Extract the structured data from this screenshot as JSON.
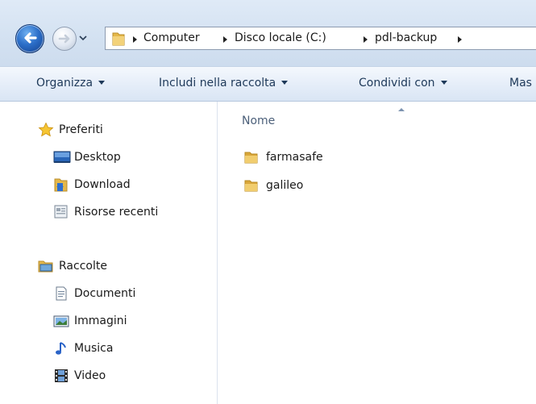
{
  "address_bar": {
    "breadcrumbs": [
      "Computer",
      "Disco locale (C:)",
      "pdl-backup"
    ]
  },
  "toolbar": {
    "organize_label": "Organizza",
    "include_label": "Includi nella raccolta",
    "share_label": "Condividi con",
    "more_label": "Mas"
  },
  "nav": {
    "favorites": {
      "label": "Preferiti",
      "items": [
        {
          "label": "Desktop",
          "icon": "desktop-icon"
        },
        {
          "label": "Download",
          "icon": "downloads-folder-icon"
        },
        {
          "label": "Risorse recenti",
          "icon": "recent-places-icon"
        }
      ]
    },
    "libraries": {
      "label": "Raccolte",
      "items": [
        {
          "label": "Documenti",
          "icon": "documents-icon"
        },
        {
          "label": "Immagini",
          "icon": "pictures-icon"
        },
        {
          "label": "Musica",
          "icon": "music-icon"
        },
        {
          "label": "Video",
          "icon": "video-icon"
        }
      ]
    }
  },
  "file_list": {
    "column_name": "Nome",
    "items": [
      {
        "name": "farmasafe",
        "type": "folder"
      },
      {
        "name": "galileo",
        "type": "folder"
      }
    ]
  },
  "colors": {
    "accent": "#2c6fc9",
    "toolbar_text": "#1e3959",
    "folder": "#e8c15a"
  }
}
